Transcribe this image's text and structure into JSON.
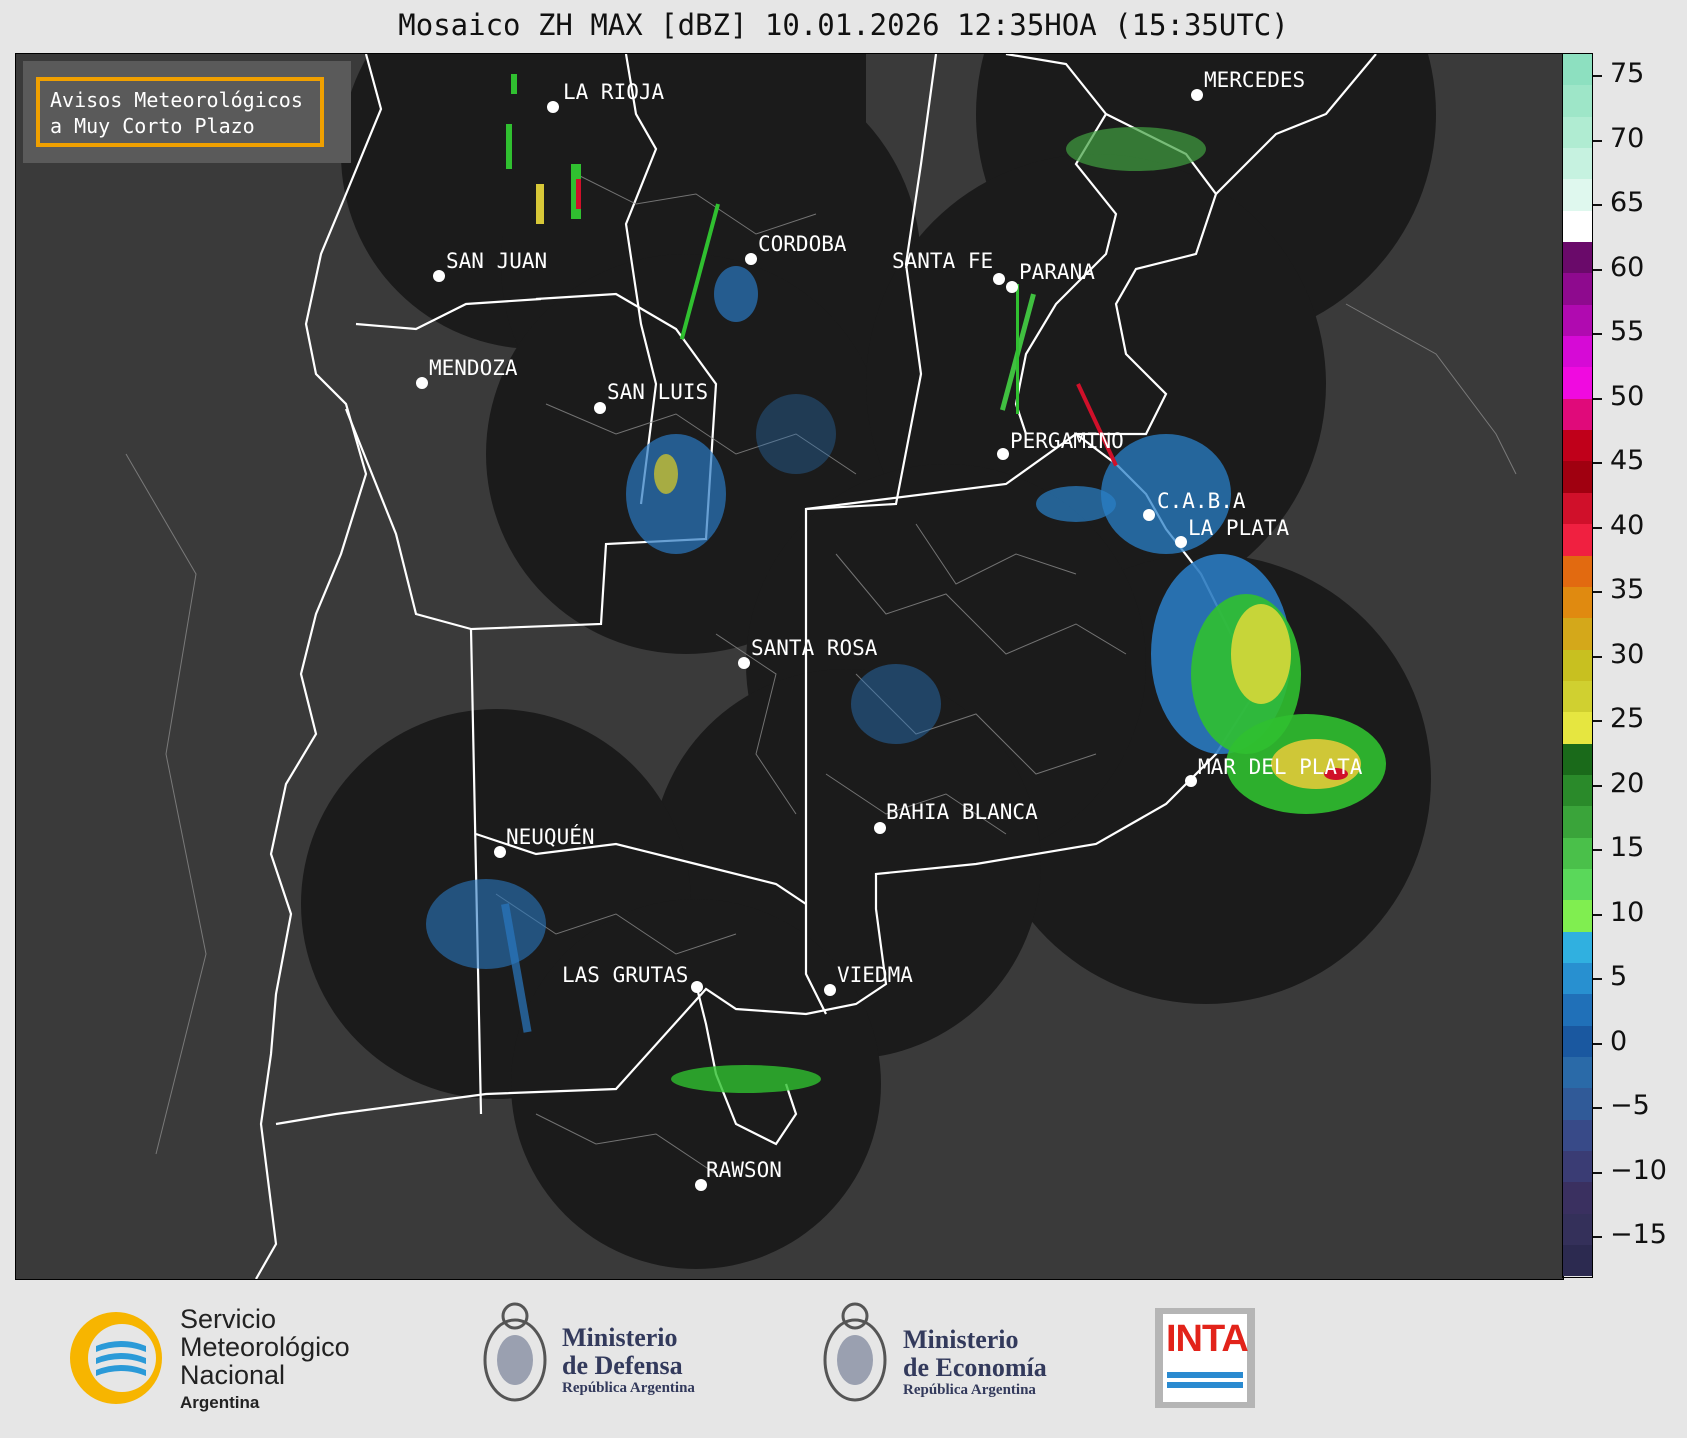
{
  "title": "Mosaico ZH MAX [dBZ] 10.01.2026 12:35HOA (15:35UTC)",
  "avisos": {
    "line1": "Avisos Meteorológicos",
    "line2": "a Muy Corto Plazo"
  },
  "cities": [
    {
      "name": "LA RIOJA"
    },
    {
      "name": "SAN JUAN"
    },
    {
      "name": "CORDOBA"
    },
    {
      "name": "SANTA FE"
    },
    {
      "name": "PARANA"
    },
    {
      "name": "MERCEDES"
    },
    {
      "name": "MENDOZA"
    },
    {
      "name": "SAN LUIS"
    },
    {
      "name": "PERGAMINO"
    },
    {
      "name": "C.A.B.A"
    },
    {
      "name": "LA PLATA"
    },
    {
      "name": "SANTA ROSA"
    },
    {
      "name": "MAR DEL PLATA"
    },
    {
      "name": "BAHIA BLANCA"
    },
    {
      "name": "NEUQUÉN"
    },
    {
      "name": "LAS GRUTAS"
    },
    {
      "name": "VIEDMA"
    },
    {
      "name": "RAWSON"
    }
  ],
  "colorbar": {
    "ticks": [
      "75",
      "70",
      "65",
      "60",
      "55",
      "50",
      "45",
      "40",
      "35",
      "30",
      "25",
      "20",
      "15",
      "10",
      "5",
      "0",
      "−5",
      "−10",
      "−15"
    ],
    "segments": [
      "#8de0c0",
      "#9ee6c8",
      "#b0ecd2",
      "#c6f2e0",
      "#dff8ee",
      "#ffffff",
      "#6a0a6a",
      "#8e0a8e",
      "#b00ab0",
      "#d60ad6",
      "#f00ae0",
      "#e00a7a",
      "#c0001a",
      "#a00010",
      "#d0102a",
      "#f02040",
      "#e26a10",
      "#e08a10",
      "#d4a81a",
      "#c8c020",
      "#d0d030",
      "#e6e640",
      "#1a6a1a",
      "#2a8a2a",
      "#3aa43a",
      "#4ac04a",
      "#5ad85a",
      "#80ee50",
      "#30b0e0",
      "#2890d0",
      "#2070b8",
      "#1a58a0",
      "#2a6aa8",
      "#305a98",
      "#384a88",
      "#3a3c74",
      "#3a3060",
      "#34305a",
      "#2c2a50"
    ]
  },
  "footer": {
    "smn": {
      "l1": "Servicio",
      "l2": "Meteorológico",
      "l3": "Nacional",
      "l4": "Argentina"
    },
    "defensa": {
      "l1": "Ministerio",
      "l2": "de Defensa",
      "l3": "República Argentina"
    },
    "economia": {
      "l1": "Ministerio",
      "l2": "de Economía",
      "l3": "República Argentina"
    },
    "inta": "INTA"
  }
}
